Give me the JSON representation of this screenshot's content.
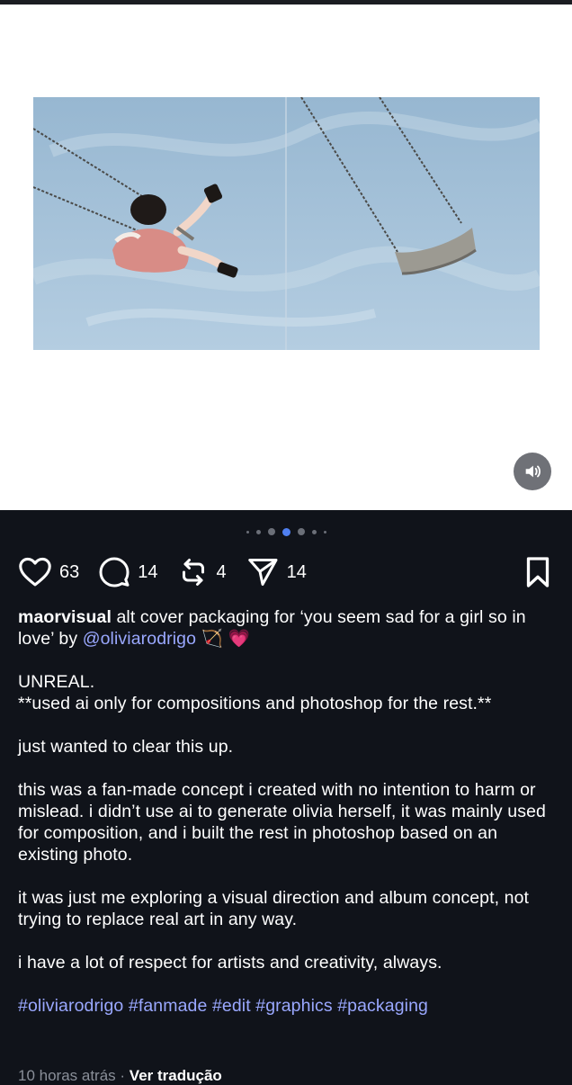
{
  "post": {
    "carousel": {
      "dots": [
        {
          "size": 3,
          "active": false
        },
        {
          "size": 5,
          "active": false
        },
        {
          "size": 8,
          "active": false
        },
        {
          "size": 9,
          "active": true
        },
        {
          "size": 8,
          "active": false
        },
        {
          "size": 5,
          "active": false
        },
        {
          "size": 3,
          "active": false
        }
      ]
    },
    "actions": {
      "likes": "63",
      "comments": "14",
      "reposts": "4",
      "shares": "14"
    },
    "caption": {
      "username": "maorvisual",
      "line1": " alt cover packaging for ‘you seem sad for a girl so in love’ by ",
      "mention": "@oliviarodrigo",
      "emoji": " 🏹 💗",
      "p1a": "UNREAL.",
      "p1b": "**used ai only for compositions and photoshop for the rest.**",
      "p2": "just wanted to clear this up.",
      "p3": "this was a fan-made concept i created with no intention to harm or mislead. i didn’t use ai to generate olivia herself, it was mainly used for composition, and i built the rest in photoshop based on an existing photo.",
      "p4": "it was just me exploring a visual direction and album concept, not trying to replace real art in any way.",
      "p5": "i have a lot of respect for artists and creativity, always.",
      "hashtags": "#oliviarodrigo #fanmade #edit #graphics #packaging"
    },
    "meta": {
      "time": "10 horas atrás",
      "separator": " · ",
      "translate": "Ver tradução"
    }
  },
  "icons": {
    "like": "heart-icon",
    "comment": "comment-icon",
    "repost": "repost-icon",
    "share": "send-icon",
    "bookmark": "bookmark-icon",
    "sound": "speaker-icon"
  },
  "colors": {
    "background": "#10131a",
    "link": "#9aa8ff",
    "active_dot": "#4f7ff0"
  }
}
